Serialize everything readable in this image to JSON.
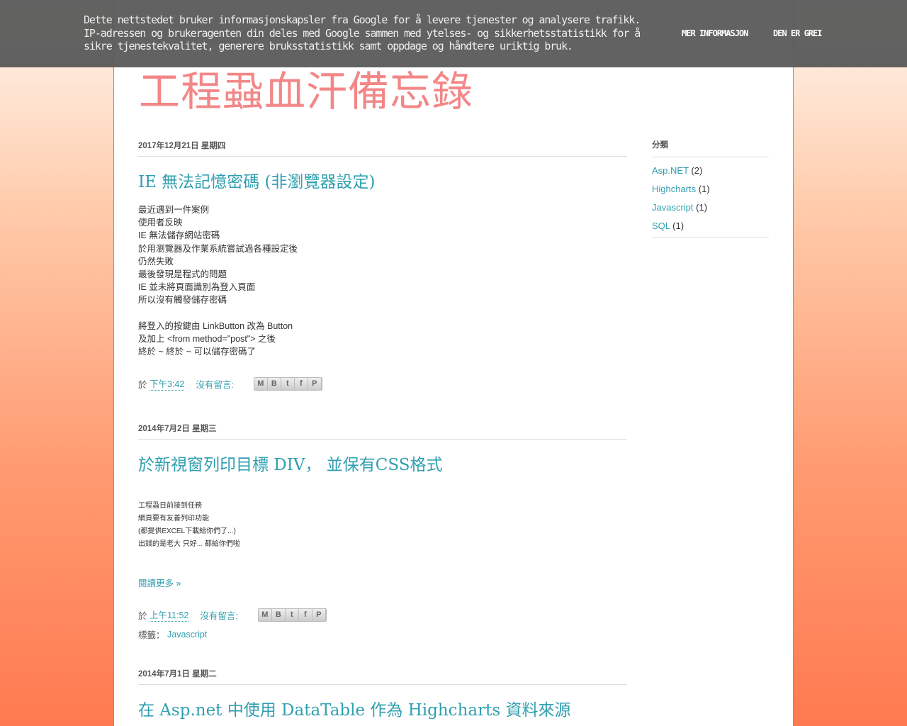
{
  "cookie": {
    "message": "Dette nettstedet bruker informasjonskapsler fra Google for å levere tjenester og analysere trafikk. IP-adressen og brukeragenten din deles med Google sammen med ytelses- og sikkerhetsstatistikk for å sikre tjenestekvalitet, generere bruksstatistikk samt oppdage og håndtere uriktig bruk.",
    "more": "MER INFORMASJON",
    "ok": "DEN ER GREI"
  },
  "blog": {
    "title": "工程蝨血汗備忘錄"
  },
  "posts": [
    {
      "date": "2017年12月21日 星期四",
      "title": "IE 無法記憶密碼 (非瀏覽器設定)",
      "lines": [
        "最近遇到一件案例",
        "使用者反映",
        "IE 無法儲存網站密碼",
        "於用瀏覽器及作業系統嘗試過各種設定後",
        "仍然失敗",
        "最後發現是程式的問題",
        "IE 並未將頁面識別為登入頁面",
        "所以沒有觸發儲存密碼",
        "",
        "將登入的按鍵由 LinkButton 改為 Button",
        "及加上  <from method=\"post\"> 之後",
        "終於 ~ 終於 ~ 可以儲存密碼了"
      ],
      "at": "於",
      "time": "下午3:42",
      "comments": "沒有留言:"
    },
    {
      "date": "2014年7月2日 星期三",
      "title": "於新視窗列印目標 DIV， 並保有CSS格式",
      "lines": [
        "工程蝨日前接到任務",
        "網頁要有友善列印功能",
        "(都提供EXCEL下載給你們了...)",
        "出錢的是老大 只好... 都給你們啦"
      ],
      "readmore": "閱讀更多 »",
      "at": "於",
      "time": "上午11:52",
      "comments": "沒有留言:",
      "labels_prefix": "標籤：",
      "label": "Javascript"
    },
    {
      "date": "2014年7月1日 星期二",
      "title": "在 Asp.net 中使用 DataTable 作為 Highcharts 資料來源"
    }
  ],
  "sidebar": {
    "heading": "分類",
    "items": [
      {
        "name": "Asp.NET",
        "count": "(2)"
      },
      {
        "name": "Highcharts",
        "count": "(1)"
      },
      {
        "name": "Javascript",
        "count": "(1)"
      },
      {
        "name": "SQL",
        "count": "(1)"
      }
    ]
  },
  "share": {
    "email": "M",
    "blog": "B",
    "twitter": "t",
    "facebook": "f",
    "pinterest": "P"
  }
}
